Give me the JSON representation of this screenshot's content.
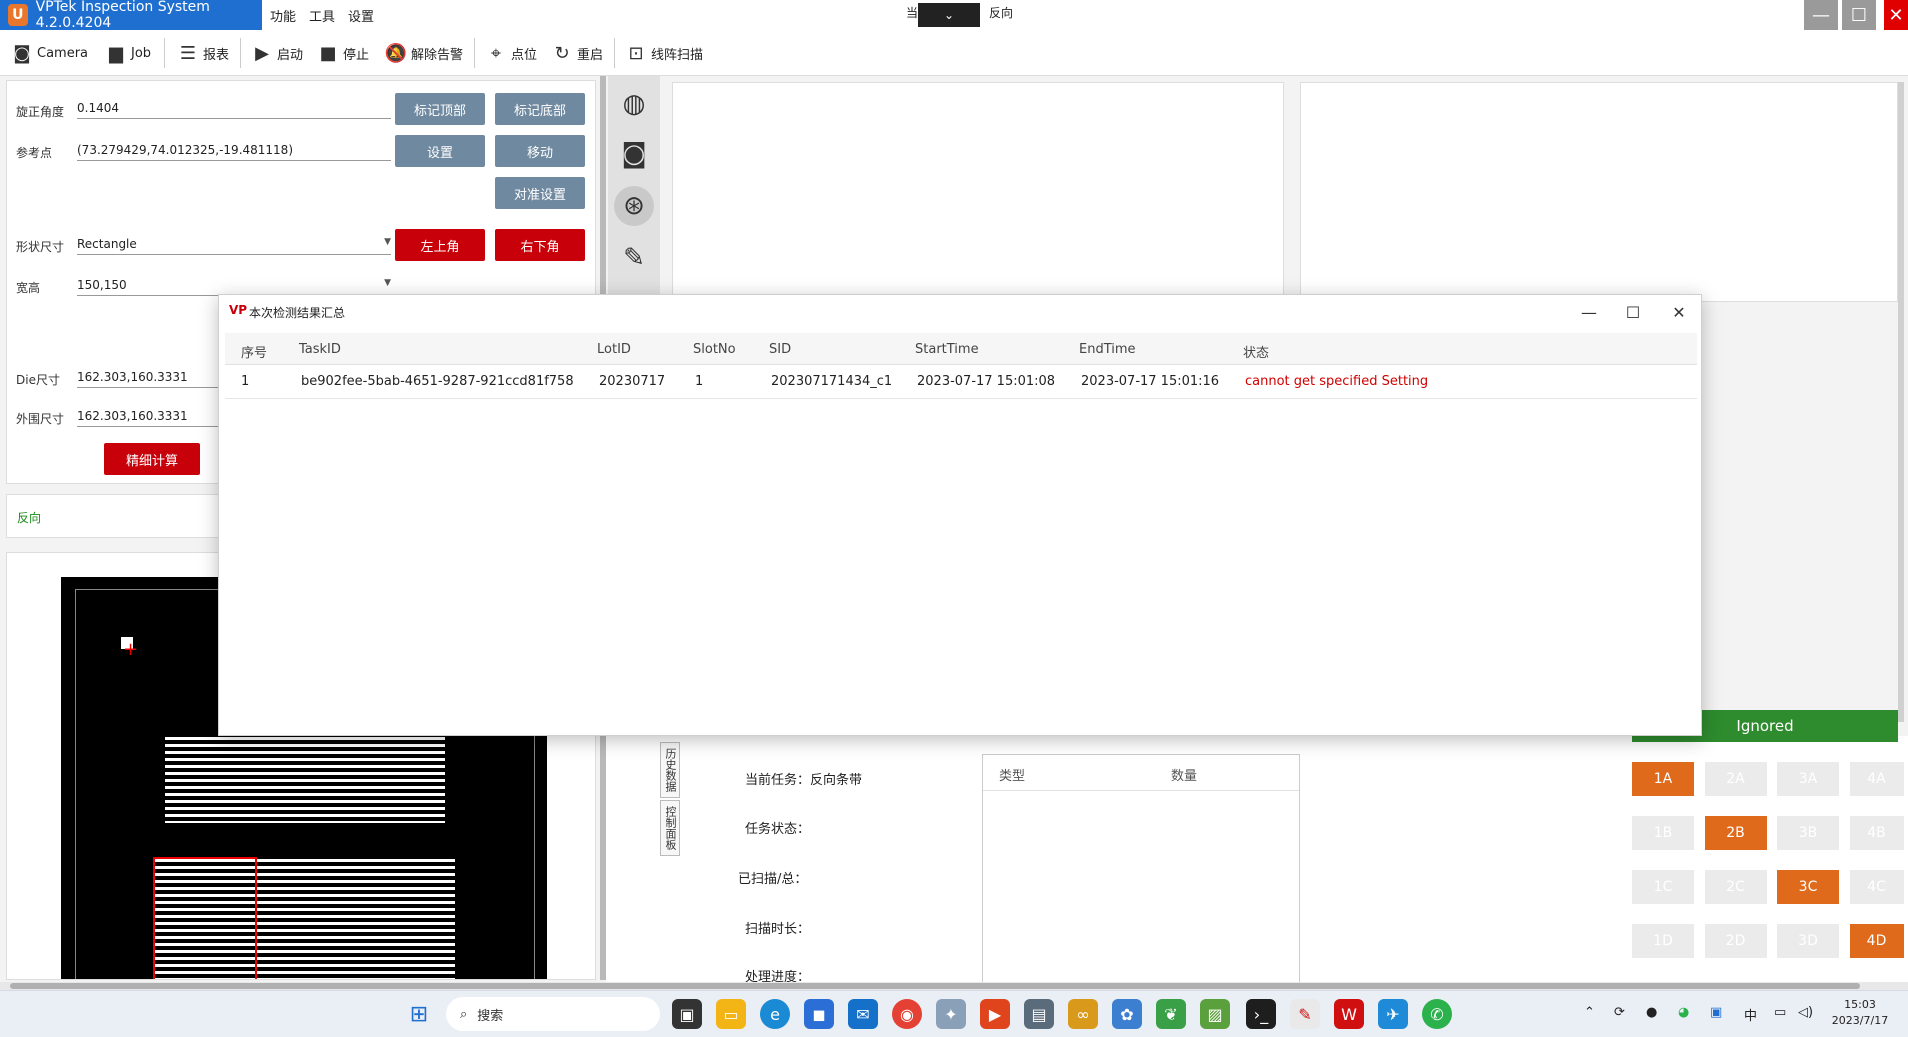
{
  "app": {
    "title": "VPTek Inspection System 4.2.0.4204",
    "logo_text": "U",
    "menus": [
      "功能",
      "工具",
      "设置"
    ],
    "center_dropdown_prefix": "当",
    "center_direction": "反向"
  },
  "toolbar": {
    "items": [
      "Camera",
      "Job",
      "报表",
      "启动",
      "停止",
      "解除告警",
      "点位",
      "重启",
      "线阵扫描"
    ]
  },
  "left_panel": {
    "rotation_label": "旋正角度",
    "rotation_value": "0.1404",
    "ref_label": "参考点",
    "ref_value": "(73.279429,74.012325,-19.481118)",
    "shape_label": "形状尺寸",
    "shape_value": "Rectangle",
    "wh_label": "宽高",
    "wh_value": "150,150",
    "die_label": "Die尺寸",
    "die_value": "162.303,160.3331",
    "outer_label": "外围尺寸",
    "outer_value": "162.303,160.3331",
    "btn_mark_top": "标记顶部",
    "btn_mark_bottom": "标记底部",
    "btn_set": "设置",
    "btn_move": "移动",
    "btn_align": "对准设置",
    "btn_top_left": "左上角",
    "btn_bottom_right": "右下角",
    "btn_fine_calc": "精细计算",
    "direction": "反向"
  },
  "bottom_info": {
    "task_label": "当前任务：反向条带",
    "status_label": "任务状态：",
    "scanned_label": "已扫描/总：",
    "duration_label": "扫描时长：",
    "progress_label": "处理进度：",
    "col_type": "类型",
    "col_count": "数量",
    "tab_history": "历史数据",
    "tab_control": "控制面板"
  },
  "slots": {
    "ignored": "Ignored",
    "grid": [
      [
        "1A",
        "2A",
        "3A",
        "4A"
      ],
      [
        "1B",
        "2B",
        "3B",
        "4B"
      ],
      [
        "1C",
        "2C",
        "3C",
        "4C"
      ],
      [
        "1D",
        "2D",
        "3D",
        "4D"
      ]
    ],
    "active": [
      "1A",
      "2B",
      "3C",
      "4D"
    ],
    "active_color": "#e06a1c"
  },
  "dialog": {
    "title": "本次检测结果汇总",
    "columns": [
      "序号",
      "TaskID",
      "LotID",
      "SlotNo",
      "SID",
      "StartTime",
      "EndTime",
      "状态"
    ],
    "row": {
      "index": "1",
      "task_id": "be902fee-5bab-4651-9287-921ccd81f758",
      "lot_id": "20230717",
      "slot_no": "1",
      "sid": "202307171434_c1",
      "start_time": "2023-07-17 15:01:08",
      "end_time": "2023-07-17 15:01:16",
      "status": "cannot get specified Setting"
    },
    "status_color": "#d10000"
  },
  "taskbar": {
    "search_placeholder": "搜索",
    "ime": "中",
    "time": "15:03",
    "date": "2023/7/17"
  }
}
